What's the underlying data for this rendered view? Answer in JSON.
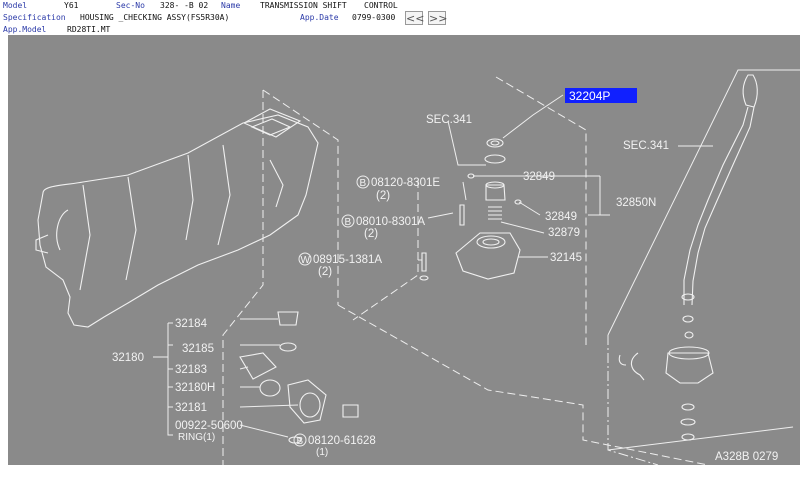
{
  "header": {
    "model_label": "Model",
    "model_value": "Y61",
    "secno_label": "Sec-No",
    "secno_value": "328-  -B 02",
    "name_label": "Name",
    "name_value": "TRANSMISSION SHIFT",
    "name_value2": "CONTROL",
    "spec_label": "Specification",
    "spec_value": "HOUSING _CHECKING ASSY(FS5R30A)",
    "appdate_label": "App.Date",
    "appdate_value": "0799-0300",
    "appmodel_label": "App.Model",
    "appmodel_value": "RD28TI.MT",
    "prev_button": "<<",
    "next_button": ">>"
  },
  "diagram": {
    "highlighted_part": "32204P",
    "labels": {
      "sec341_center": "SEC.341",
      "sec341_right": "SEC.341",
      "p32849a": "32849",
      "p32850n": "32850N",
      "p32849b": "32849",
      "p32879": "32879",
      "p32145": "32145",
      "bolt1": "08120-8301E",
      "bolt1_qty": "(2)",
      "bolt2": "08010-8301A",
      "bolt2_qty": "(2)",
      "washer": "08915-1381A",
      "washer_qty": "(2)",
      "p32184": "32184",
      "p32180": "32180",
      "p32185": "32185",
      "p32183": "32183",
      "p32180h": "32180H",
      "p32181": "32181",
      "p00922": "00922-50600",
      "ring": "RING(1)",
      "bolt3": "08120-61628",
      "bolt3_qty": "(1)",
      "ref_code": "A328B 0279",
      "prefix_b": "B",
      "prefix_w": "W"
    }
  }
}
